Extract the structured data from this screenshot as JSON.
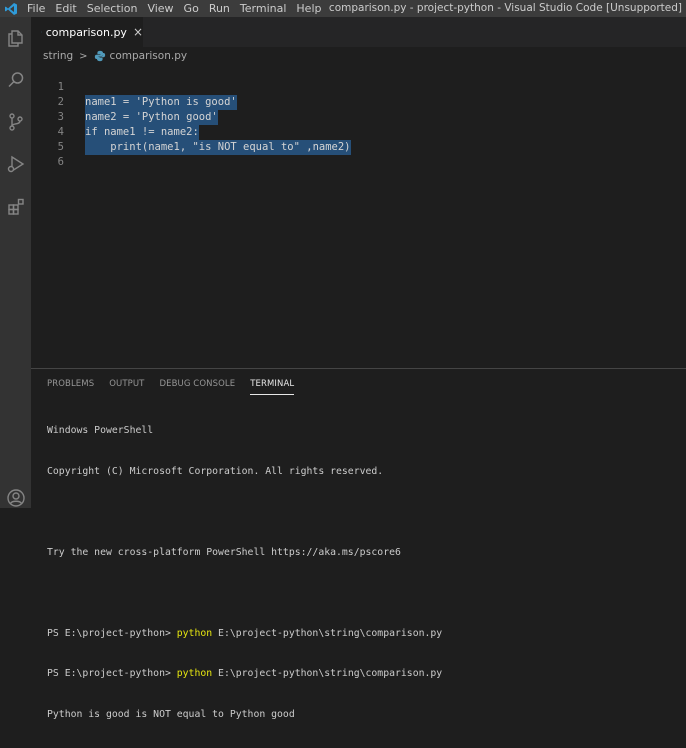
{
  "titlebar": {
    "menu": [
      "File",
      "Edit",
      "Selection",
      "View",
      "Go",
      "Run",
      "Terminal",
      "Help"
    ],
    "window_title": "comparison.py - project-python - Visual Studio Code [Unsupported]"
  },
  "activitybar": {
    "icons": [
      "explorer-icon",
      "search-icon",
      "source-control-icon",
      "run-debug-icon",
      "extensions-icon",
      "account-icon"
    ]
  },
  "tabs": [
    {
      "label": "comparison.py",
      "close": "×"
    }
  ],
  "breadcrumb": {
    "folder": "string",
    "separator": ">",
    "file": "comparison.py"
  },
  "editor": {
    "lines": [
      {
        "number": "1",
        "code": "name1 = 'Python is good'"
      },
      {
        "number": "2",
        "code": "name2 = 'Python good'"
      },
      {
        "number": "3",
        "code": "if name1 != name2:"
      },
      {
        "number": "4",
        "code": "    print(name1, \"is NOT equal to\" ,name2)"
      },
      {
        "number": "5",
        "code": ""
      },
      {
        "number": "6",
        "code": ""
      }
    ]
  },
  "panel": {
    "tabs": [
      {
        "label": "PROBLEMS",
        "active": false
      },
      {
        "label": "OUTPUT",
        "active": false
      },
      {
        "label": "DEBUG CONSOLE",
        "active": false
      },
      {
        "label": "TERMINAL",
        "active": true
      }
    ],
    "terminal": {
      "line1": "Windows PowerShell",
      "line2": "Copyright (C) Microsoft Corporation. All rights reserved.",
      "line3": "Try the new cross-platform PowerShell https://aka.ms/pscore6",
      "prompt": "PS E:\\project-python> ",
      "command": "python",
      "argument": " E:\\project-python\\string\\comparison.py",
      "output": "Python is good is NOT equal to Python good"
    }
  },
  "colors": {
    "selection": "#264f78",
    "accent_python": "#519aba",
    "terminal_command": "#e5e510"
  }
}
